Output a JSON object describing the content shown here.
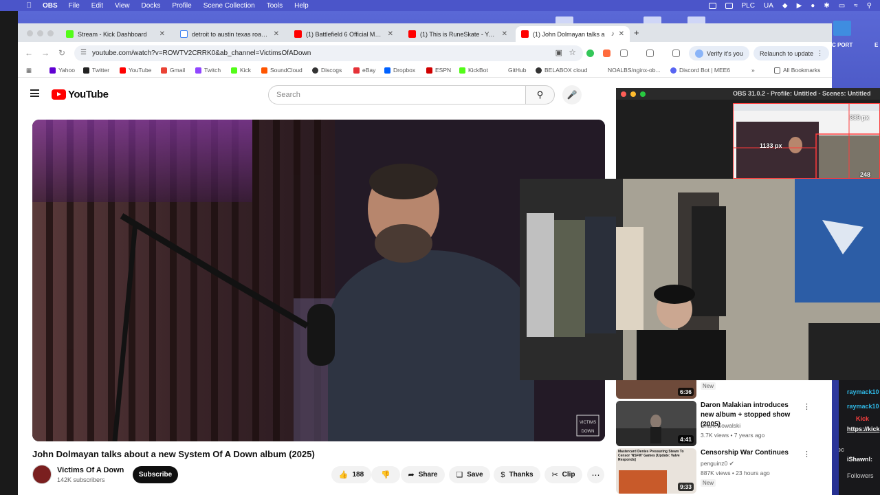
{
  "menubar": {
    "app_name": "OBS",
    "items": [
      "File",
      "Edit",
      "View",
      "Docks",
      "Profile",
      "Scene Collection",
      "Tools",
      "Help"
    ],
    "status_plc": "PLC",
    "status_ua": "UA"
  },
  "desktop": {
    "label_port": "C PORT",
    "label_e": "E"
  },
  "browser": {
    "tabs": [
      {
        "title": "Stream - Kick Dashboard",
        "favicon": "kick-icon",
        "color": "#53fc18"
      },
      {
        "title": "detroit to austin texas road trip",
        "favicon": "google-icon",
        "color": "#4285f4"
      },
      {
        "title": "(1) Battlefield 6 Official Multiplayer",
        "favicon": "youtube-icon",
        "color": "#ff0000"
      },
      {
        "title": "(1) This is RuneSkate - YouTube",
        "favicon": "youtube-icon",
        "color": "#ff0000"
      },
      {
        "title": "(1) John Dolmayan talks a",
        "favicon": "youtube-icon",
        "color": "#ff0000"
      }
    ],
    "url": "youtube.com/watch?v=ROWTV2CRRK0&ab_channel=VictimsOfADown",
    "verify_label": "Verify it's you",
    "relaunch_label": "Relaunch to update",
    "bookmarks": [
      {
        "label": "Yahoo",
        "color": "#6001d2"
      },
      {
        "label": "Twitter",
        "color": "#222222"
      },
      {
        "label": "YouTube",
        "color": "#ff0000"
      },
      {
        "label": "Gmail",
        "color": "#ea4335"
      },
      {
        "label": "Twitch",
        "color": "#9146ff"
      },
      {
        "label": "Kick",
        "color": "#53fc18"
      },
      {
        "label": "SoundCloud",
        "color": "#ff5500"
      },
      {
        "label": "Discogs",
        "color": "#333333"
      },
      {
        "label": "eBay",
        "color": "#e53238"
      },
      {
        "label": "Dropbox",
        "color": "#0061ff"
      },
      {
        "label": "ESPN",
        "color": "#d00000"
      },
      {
        "label": "KickBot",
        "color": "#53fc18"
      },
      {
        "label": "GitHub",
        "color": "#ffffff"
      },
      {
        "label": "BELABOX cloud",
        "color": "#333333"
      },
      {
        "label": "NOALBS/nginx-ob...",
        "color": "#ffffff"
      },
      {
        "label": "Discord Bot | MEE6",
        "color": "#5865f2"
      }
    ],
    "all_bookmarks": "All Bookmarks"
  },
  "youtube": {
    "logo_text": "YouTube",
    "search_placeholder": "Search",
    "video": {
      "title": "John Dolmayan talks about a new System Of A Down album (2025)",
      "channel": "Victims Of A Down",
      "subscribers": "142K subscribers",
      "subscribe_label": "Subscribe",
      "likes": "188",
      "share_label": "Share",
      "save_label": "Save",
      "thanks_label": "Thanks",
      "clip_label": "Clip",
      "watermark_line1": "VICTIMS",
      "watermark_line2": "DOWN"
    },
    "recommendations": [
      {
        "title": "",
        "channel": "",
        "meta": "",
        "duration": "6:36",
        "badge": "New"
      },
      {
        "title": "Daron Malakian introduces new album + stopped show (2005)",
        "channel": "Shark Kowalski",
        "meta": "3.7K views • 7 years ago",
        "duration": "4:41",
        "badge": ""
      },
      {
        "title": "Censorship War Continues",
        "channel": "penguinz0",
        "meta": "887K views • 23 hours ago",
        "duration": "9:33",
        "badge": "New",
        "thumb_text": "Mastercard Denies Pressuring Steam To Censor 'NSFW' Games [Update: Valve Responds]"
      }
    ]
  },
  "obs": {
    "title": "OBS 31.0.2 - Profile: Untitled - Scenes: Untitled",
    "px_top": "389 px",
    "px_left": "1133 px",
    "px_bottom": "248 px"
  },
  "chat": {
    "lines": [
      "raymack10",
      "raymack10",
      "Kick",
      "https://kick",
      "jpc",
      "iShawnl:",
      "Followers"
    ]
  }
}
